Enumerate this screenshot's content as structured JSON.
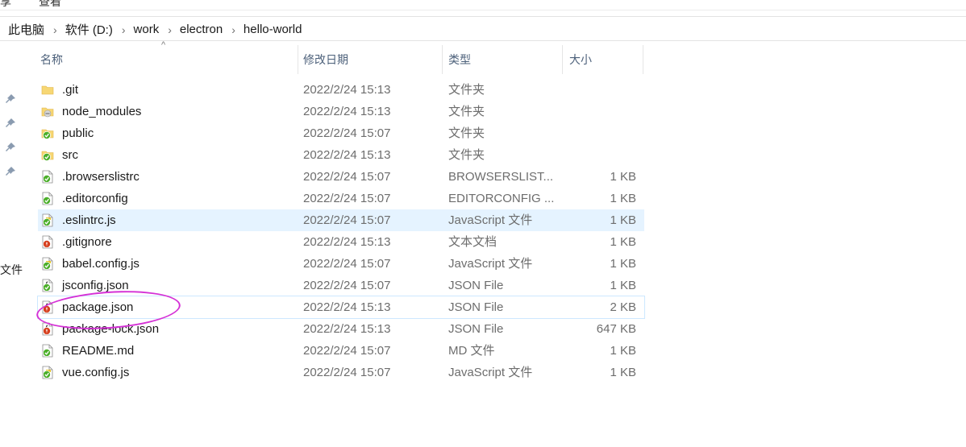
{
  "top_menu": [
    "享",
    "查看"
  ],
  "breadcrumb": [
    "此电脑",
    "软件 (D:)",
    "work",
    "electron",
    "hello-world"
  ],
  "breadcrumb_separator": "›",
  "side_label": "文件",
  "columns": {
    "name": "名称",
    "date": "修改日期",
    "type": "类型",
    "size": "大小"
  },
  "sort_indicator": "^",
  "files": [
    {
      "name": ".git",
      "date": "2022/2/24 15:13",
      "type": "文件夹",
      "size": "",
      "icon": "folder-icon"
    },
    {
      "name": "node_modules",
      "date": "2022/2/24 15:13",
      "type": "文件夹",
      "size": "",
      "icon": "folder-ignored-icon"
    },
    {
      "name": "public",
      "date": "2022/2/24 15:07",
      "type": "文件夹",
      "size": "",
      "icon": "folder-synced-icon"
    },
    {
      "name": "src",
      "date": "2022/2/24 15:13",
      "type": "文件夹",
      "size": "",
      "icon": "folder-synced-icon"
    },
    {
      "name": ".browserslistrc",
      "date": "2022/2/24 15:07",
      "type": "BROWSERSLIST...",
      "size": "1 KB",
      "icon": "file-synced-icon"
    },
    {
      "name": ".editorconfig",
      "date": "2022/2/24 15:07",
      "type": "EDITORCONFIG ...",
      "size": "1 KB",
      "icon": "file-synced-icon"
    },
    {
      "name": ".eslintrc.js",
      "date": "2022/2/24 15:07",
      "type": "JavaScript 文件",
      "size": "1 KB",
      "icon": "js-file-synced-icon"
    },
    {
      "name": ".gitignore",
      "date": "2022/2/24 15:13",
      "type": "文本文档",
      "size": "1 KB",
      "icon": "file-modified-icon"
    },
    {
      "name": "babel.config.js",
      "date": "2022/2/24 15:07",
      "type": "JavaScript 文件",
      "size": "1 KB",
      "icon": "js-file-synced-icon"
    },
    {
      "name": "jsconfig.json",
      "date": "2022/2/24 15:07",
      "type": "JSON File",
      "size": "1 KB",
      "icon": "json-file-synced-icon"
    },
    {
      "name": "package.json",
      "date": "2022/2/24 15:13",
      "type": "JSON File",
      "size": "2 KB",
      "icon": "json-file-modified-icon"
    },
    {
      "name": "package-lock.json",
      "date": "2022/2/24 15:13",
      "type": "JSON File",
      "size": "647 KB",
      "icon": "json-file-modified-icon"
    },
    {
      "name": "README.md",
      "date": "2022/2/24 15:07",
      "type": "MD 文件",
      "size": "1 KB",
      "icon": "file-synced-icon"
    },
    {
      "name": "vue.config.js",
      "date": "2022/2/24 15:07",
      "type": "JavaScript 文件",
      "size": "1 KB",
      "icon": "js-file-synced-icon"
    }
  ],
  "selected_row": 6,
  "highlighted_row": 10,
  "colors": {
    "synced": "#4caf2a",
    "modified": "#d6401f",
    "folder": "#f7d774",
    "annotation": "#d531d6",
    "selection": "#e5f3ff"
  }
}
